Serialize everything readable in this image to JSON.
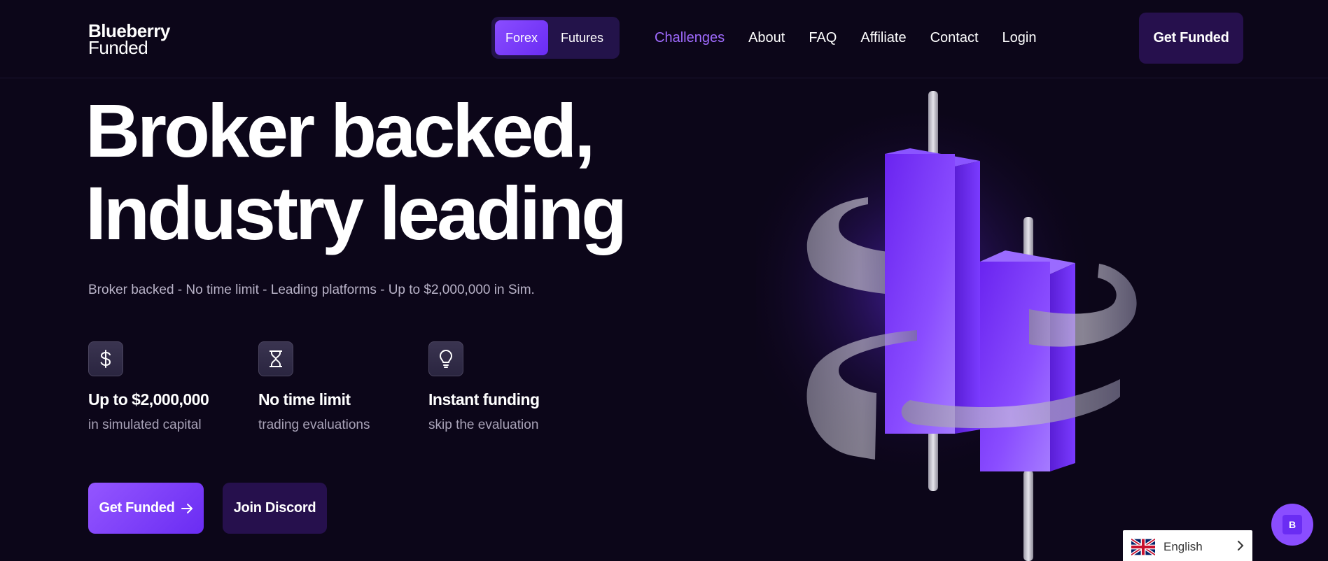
{
  "brand": {
    "line1": "Blueberry",
    "line2": "Funded"
  },
  "market_toggle": {
    "options": [
      "Forex",
      "Futures"
    ],
    "selected": "Forex"
  },
  "nav": {
    "items": [
      "Challenges",
      "About",
      "FAQ",
      "Affiliate",
      "Contact",
      "Login"
    ],
    "active": "Challenges"
  },
  "header_cta": "Get Funded",
  "hero": {
    "title_line1": "Broker backed,",
    "title_line2": "Industry leading",
    "subtitle": "Broker backed - No time limit - Leading platforms - Up to $2,000,000 in Sim."
  },
  "features": [
    {
      "icon": "dollar-icon",
      "title": "Up to $2,000,000",
      "subtitle": "in simulated capital"
    },
    {
      "icon": "hourglass-icon",
      "title": "No time limit",
      "subtitle": "trading evaluations"
    },
    {
      "icon": "lightbulb-icon",
      "title": "Instant funding",
      "subtitle": "skip the evaluation"
    }
  ],
  "buttons": {
    "primary": "Get Funded",
    "secondary": "Join Discord"
  },
  "language": {
    "label": "English"
  },
  "chat": {
    "label": "B"
  },
  "colors": {
    "background": "#0c0619",
    "accent": "#8a4dff",
    "active_nav": "#a06bff",
    "button_dark": "#26104d"
  }
}
